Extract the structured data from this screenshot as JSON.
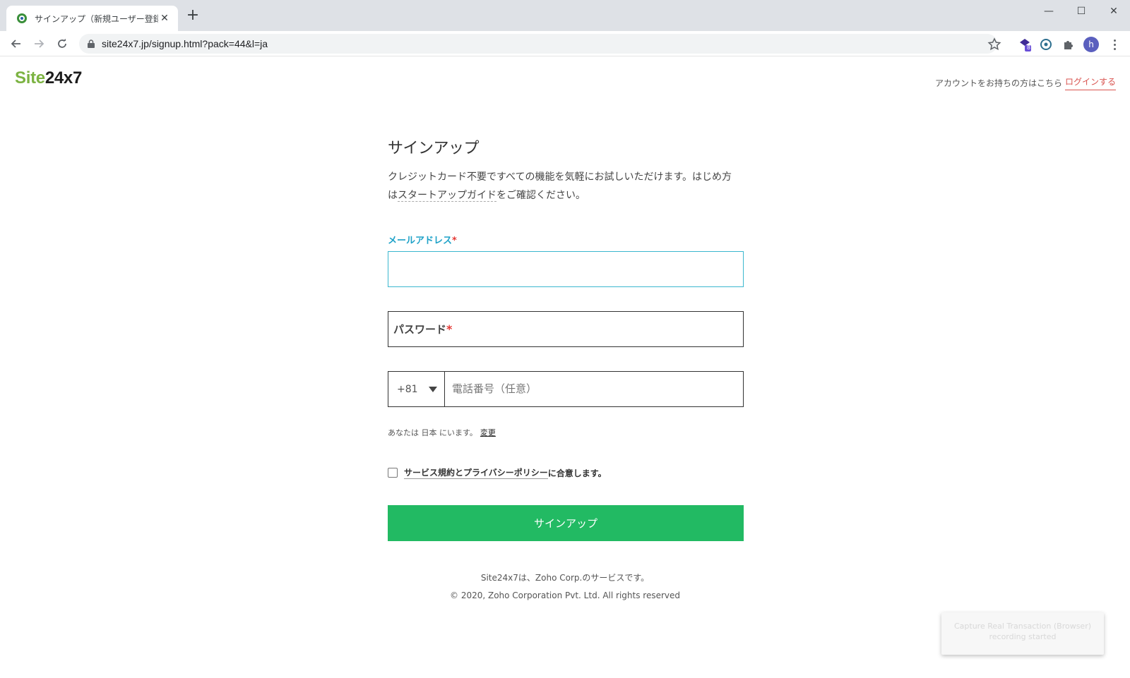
{
  "browser": {
    "tab_title": "サインアップ（新規ユーザー登録）：",
    "close_tab_glyph": "✕",
    "new_tab_glyph": "+",
    "url": "site24x7.jp/signup.html?pack=44&l=ja",
    "extension_badge": "8",
    "avatar_letter": "h",
    "minimize_glyph": "—",
    "maximize_glyph": "☐",
    "close_window_glyph": "✕"
  },
  "logo": {
    "part_site": "Site",
    "part_num": "24x7",
    "site_color": "#7cb342"
  },
  "header": {
    "account_prompt": "アカウントをお持ちの方はこちら",
    "login_link": "ログインする"
  },
  "form": {
    "title": "サインアップ",
    "description_main": "クレジットカード不要ですべての機能を気軽にお試しいただけます。はじめ方は",
    "description_link": "スタートアップガイド",
    "description_tail": "をご確認ください。",
    "email_label": "メールアドレス",
    "email_value": "",
    "password_label": "パスワード",
    "required_mark": "*",
    "country_code": "+81",
    "phone_placeholder": "電話番号（任意）",
    "location_prefix": "あなたは 日本 にいます。",
    "location_change": "変更",
    "agree_link": "サービス規約とプライバシーポリシー",
    "agree_tail": "に合意します。",
    "agree_checked": false,
    "submit_label": "サインアップ",
    "accent_color": "#22ba63",
    "label_color": "#1fa2c8"
  },
  "footer": {
    "service_note": "Site24x7は、Zoho Corp.のサービスです。",
    "copyright": "© 2020, Zoho Corporation Pvt. Ltd. All rights reserved"
  },
  "toast": {
    "line1": "Capture Real Transaction (Browser)",
    "line2": "recording started"
  }
}
